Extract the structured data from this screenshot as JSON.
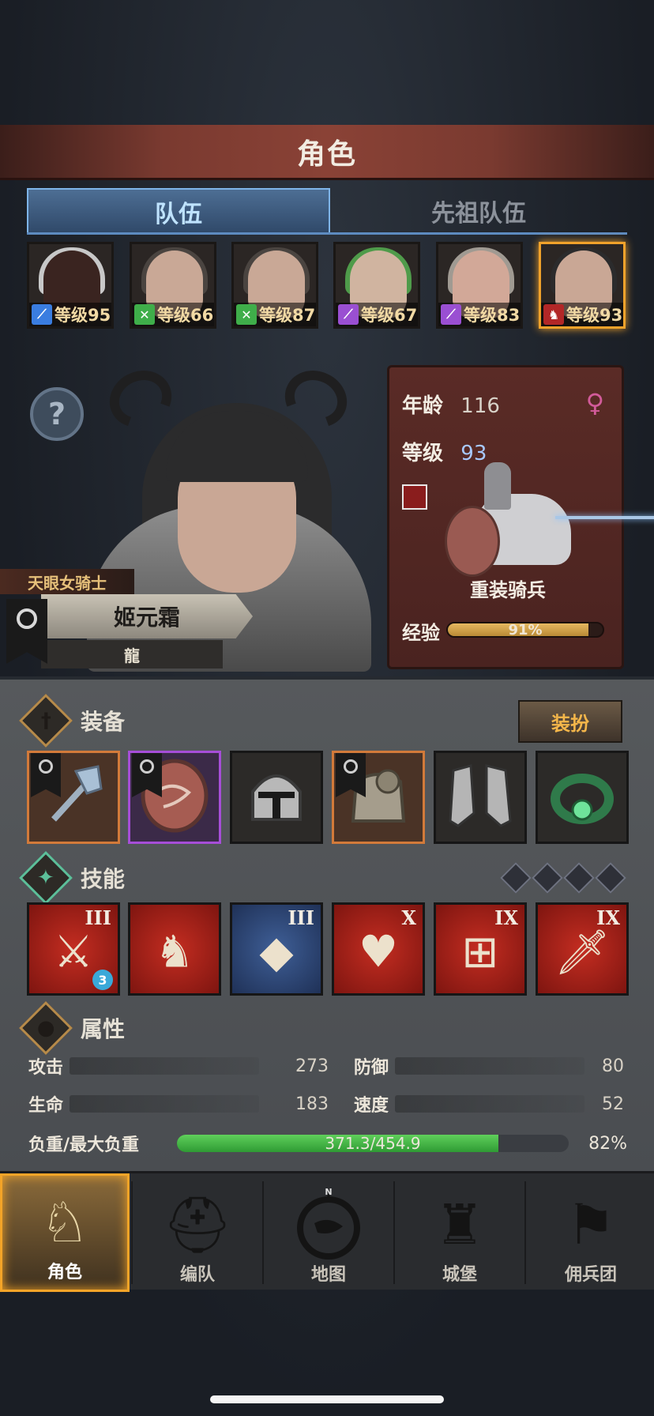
{
  "header": {
    "title": "角色"
  },
  "tabs": [
    {
      "label": "队伍",
      "active": true
    },
    {
      "label": "先祖队伍",
      "active": false
    }
  ],
  "party": [
    {
      "level_text": "等级95",
      "class_icon": "spear-icon",
      "class_color": "#3a7de0",
      "selected": false
    },
    {
      "level_text": "等级66",
      "class_icon": "crossbow-icon",
      "class_color": "#3fae4a",
      "selected": false
    },
    {
      "level_text": "等级87",
      "class_icon": "crossbow-icon",
      "class_color": "#3fae4a",
      "selected": false
    },
    {
      "level_text": "等级67",
      "class_icon": "staff-icon",
      "class_color": "#9a4fd2",
      "selected": false
    },
    {
      "level_text": "等级83",
      "class_icon": "staff-icon",
      "class_color": "#9a4fd2",
      "selected": false
    },
    {
      "level_text": "等级93",
      "class_icon": "horse-icon",
      "class_color": "#b22727",
      "selected": true
    }
  ],
  "hero": {
    "title": "天眼女骑士",
    "name": "姬元霜",
    "guild": "龍"
  },
  "info": {
    "age_label": "年龄",
    "age": "116",
    "level_label": "等级",
    "level": "93",
    "gender_icon": "female-icon",
    "unit": "重装骑兵",
    "exp_label": "经验",
    "exp_percent": 91,
    "exp_text": "91%"
  },
  "equipment": {
    "title": "装备",
    "outfit_button": "装扮",
    "slots": [
      {
        "icon": "axe-icon",
        "rarity": "orange",
        "marked": true
      },
      {
        "icon": "shield-icon",
        "rarity": "purple",
        "marked": true
      },
      {
        "icon": "helmet-icon",
        "rarity": "none",
        "marked": false
      },
      {
        "icon": "armor-icon",
        "rarity": "orange",
        "marked": true
      },
      {
        "icon": "greaves-icon",
        "rarity": "none",
        "marked": false
      },
      {
        "icon": "ring-icon",
        "rarity": "none",
        "marked": false
      }
    ]
  },
  "skills": {
    "title": "技能",
    "items": [
      {
        "icon": "broken-sword-icon",
        "rank": "III",
        "color": "red",
        "badge": "3"
      },
      {
        "icon": "horse-up-icon",
        "rank": "",
        "color": "red",
        "badge": ""
      },
      {
        "icon": "crystal-sword-icon",
        "rank": "III",
        "color": "blue",
        "badge": ""
      },
      {
        "icon": "heart-icon",
        "rank": "X",
        "color": "red",
        "badge": ""
      },
      {
        "icon": "dumbbell-icon",
        "rank": "IX",
        "color": "red",
        "badge": ""
      },
      {
        "icon": "sword-icon",
        "rank": "IX",
        "color": "red",
        "badge": ""
      }
    ]
  },
  "attributes": {
    "title": "属性",
    "attack_label": "攻击",
    "attack": "273",
    "defense_label": "防御",
    "defense": "80",
    "hp_label": "生命",
    "hp": "183",
    "speed_label": "速度",
    "speed": "52",
    "load_label": "负重/最大负重",
    "load_text": "371.3/454.9",
    "load_percent_value": 82,
    "load_percent": "82%"
  },
  "nav": [
    {
      "label": "角色",
      "icon": "knight-icon",
      "active": true
    },
    {
      "label": "编队",
      "icon": "helmet-icon",
      "active": false
    },
    {
      "label": "地图",
      "icon": "compass-map-icon",
      "active": false,
      "compass_mark": "N"
    },
    {
      "label": "城堡",
      "icon": "castle-icon",
      "active": false
    },
    {
      "label": "佣兵团",
      "icon": "banner-icon",
      "active": false
    }
  ]
}
